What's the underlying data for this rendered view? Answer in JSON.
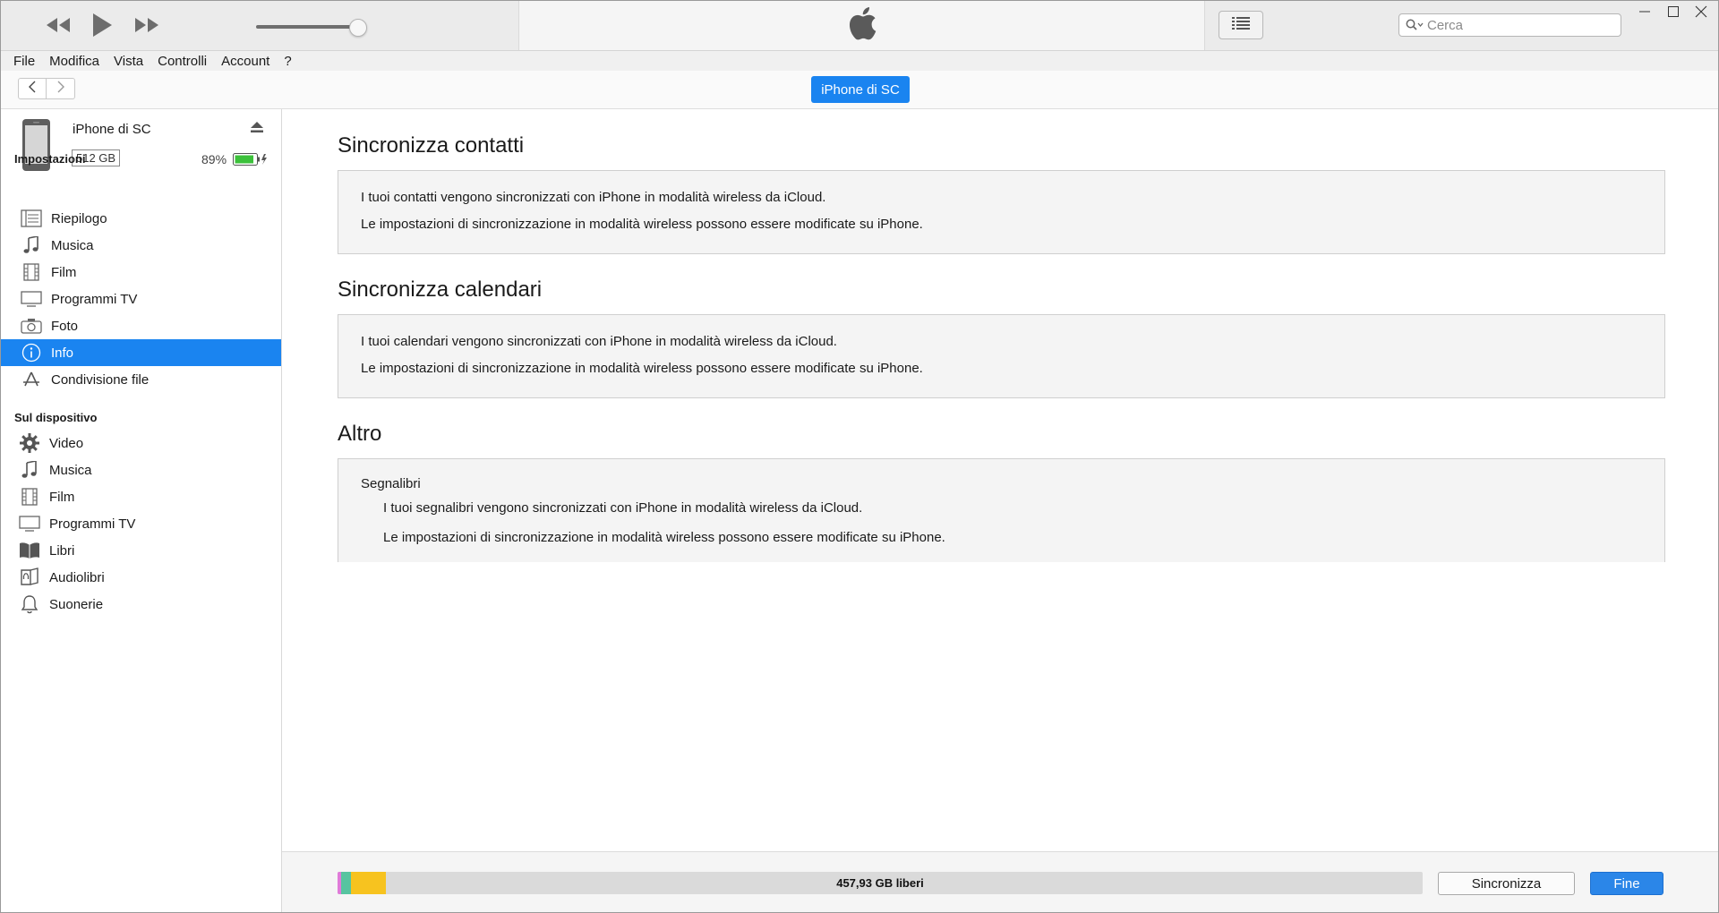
{
  "window": {
    "controls": {
      "minimize_icon": "minimize-icon",
      "maximize_icon": "maximize-icon",
      "close_icon": "close-icon"
    }
  },
  "player": {
    "rewind_icon": "rewind-icon",
    "play_icon": "play-icon",
    "forward_icon": "fast-forward-icon",
    "volume_level": 0.9,
    "logo_icon": "apple-logo-icon",
    "list_icon": "list-view-icon"
  },
  "search": {
    "placeholder": "Cerca"
  },
  "menu": [
    "File",
    "Modifica",
    "Vista",
    "Controlli",
    "Account",
    "?"
  ],
  "nav": {
    "device_button": "iPhone di SC"
  },
  "device": {
    "name": "iPhone di SC",
    "capacity": "512 GB",
    "battery_percent": "89%",
    "battery_level": 0.89
  },
  "sidebar": {
    "settings_title": "Impostazioni",
    "settings_items": [
      {
        "label": "Riepilogo",
        "icon": "summary-list-icon"
      },
      {
        "label": "Musica",
        "icon": "music-note-icon"
      },
      {
        "label": "Film",
        "icon": "film-icon"
      },
      {
        "label": "Programmi TV",
        "icon": "tv-icon"
      },
      {
        "label": "Foto",
        "icon": "camera-icon"
      },
      {
        "label": "Info",
        "icon": "info-icon",
        "active": true
      },
      {
        "label": "Condivisione file",
        "icon": "apps-icon"
      }
    ],
    "device_title": "Sul dispositivo",
    "device_items": [
      {
        "label": "Video",
        "icon": "gear-icon"
      },
      {
        "label": "Musica",
        "icon": "music-note-icon"
      },
      {
        "label": "Film",
        "icon": "film-icon"
      },
      {
        "label": "Programmi TV",
        "icon": "tv-icon"
      },
      {
        "label": "Libri",
        "icon": "book-icon"
      },
      {
        "label": "Audiolibri",
        "icon": "audiobook-icon"
      },
      {
        "label": "Suonerie",
        "icon": "bell-icon"
      }
    ]
  },
  "main": {
    "contacts": {
      "title": "Sincronizza contatti",
      "line1": "I tuoi contatti vengono sincronizzati con iPhone in modalità wireless da iCloud.",
      "line2": "Le impostazioni di sincronizzazione in modalità wireless possono essere modificate su iPhone."
    },
    "calendars": {
      "title": "Sincronizza calendari",
      "line1": "I tuoi calendari vengono sincronizzati con iPhone in modalità wireless da iCloud.",
      "line2": "Le impostazioni di sincronizzazione in modalità wireless possono essere modificate su iPhone."
    },
    "other": {
      "title": "Altro",
      "subtitle": "Segnalibri",
      "line1": "I tuoi segnalibri vengono sincronizzati con iPhone in modalità wireless da iCloud.",
      "line2": "Le impostazioni di sincronizzazione in modalità wireless possono essere modificate su iPhone."
    }
  },
  "footer": {
    "storage_free": "457,93 GB liberi",
    "storage_segments": [
      {
        "color": "#e07bd9",
        "fraction": 0.003
      },
      {
        "color": "#57c4a0",
        "fraction": 0.009
      },
      {
        "color": "#f7c31f",
        "fraction": 0.032
      }
    ],
    "sync_button": "Sincronizza",
    "done_button": "Fine"
  },
  "colors": {
    "accent": "#1a84f0",
    "battery": "#3cc13b"
  }
}
